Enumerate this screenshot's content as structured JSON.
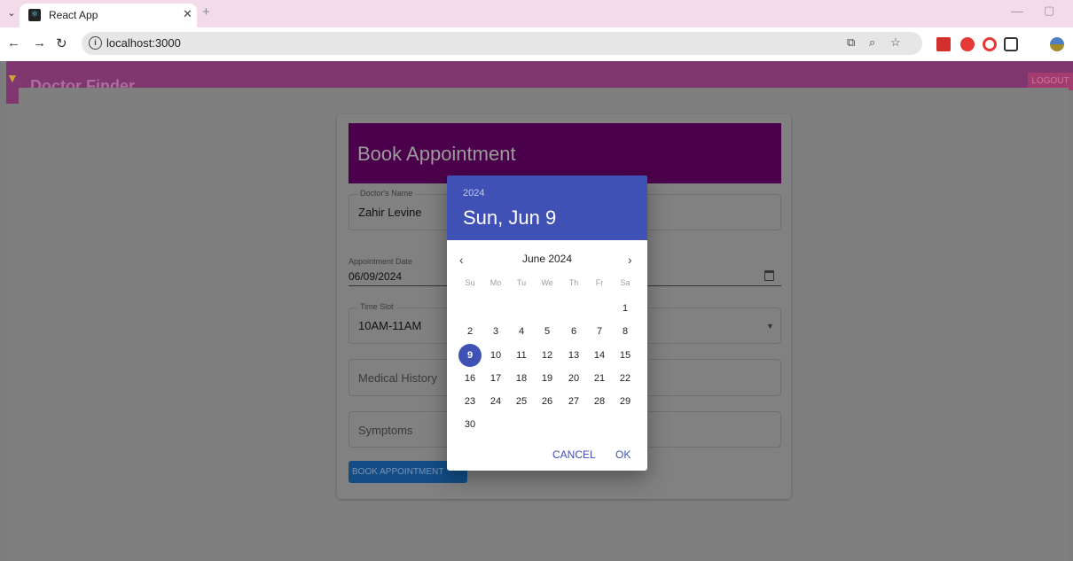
{
  "browser": {
    "tab_title": "React App",
    "url": "localhost:3000",
    "icons": [
      "tab-menu-icon",
      "react-favicon-icon",
      "close-icon",
      "plus-icon",
      "back-icon",
      "forward-icon",
      "reload-icon",
      "info-icon",
      "cast-icon",
      "zoom-icon",
      "star-icon",
      "extension-red-icon",
      "adblock-icon",
      "opera-icon",
      "puzzle-icon",
      "profile-avatar-icon"
    ]
  },
  "app": {
    "title": "Doctor Finder",
    "logout_label": "LOGOUT"
  },
  "form": {
    "title": "Book Appointment",
    "doctor_name_label": "Doctor's Name",
    "doctor_name_value": "Zahir Levine",
    "appointment_date_label": "Appointment Date",
    "appointment_date_value": "06/09/2024",
    "time_slot_label": "Time Slot",
    "time_slot_value": "10AM-11AM",
    "medical_history_placeholder": "Medical History",
    "symptoms_placeholder": "Symptoms",
    "submit_label": "BOOK APPOINTMENT"
  },
  "date_picker": {
    "year": "2024",
    "selected_date_text": "Sun, Jun 9",
    "month_label": "June 2024",
    "prev_glyph": "‹",
    "next_glyph": "›",
    "weekdays": [
      "Su",
      "Mo",
      "Tu",
      "We",
      "Th",
      "Fr",
      "Sa"
    ],
    "days": [
      "1",
      "2",
      "3",
      "4",
      "5",
      "6",
      "7",
      "8",
      "9",
      "10",
      "11",
      "12",
      "13",
      "14",
      "15",
      "16",
      "17",
      "18",
      "19",
      "20",
      "21",
      "22",
      "23",
      "24",
      "25",
      "26",
      "27",
      "28",
      "29",
      "30"
    ],
    "selected_day": "9",
    "cancel_label": "CANCEL",
    "ok_label": "OK"
  },
  "colors": {
    "picker_accent": "#3f51b5",
    "header_purple": "#80366e",
    "card_header": "#4b004b"
  }
}
